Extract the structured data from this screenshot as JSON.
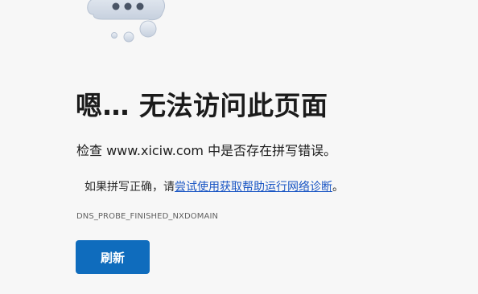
{
  "error_page": {
    "title": "嗯… 无法访问此页面",
    "check_prefix": "检查 ",
    "domain": "www.xiciw.com",
    "check_suffix": " 中是否存在拼写错误。",
    "suggest_prefix": "如果拼写正确，请",
    "suggest_link": "尝试使用获取帮助运行网络诊断",
    "suggest_suffix": "。",
    "error_code": "DNS_PROBE_FINISHED_NXDOMAIN",
    "refresh_label": "刷新",
    "icon": "thinking-cloud-icon"
  },
  "colors": {
    "background": "#f7f7f7",
    "button": "#0f6cbd",
    "link": "#1a56c4"
  }
}
